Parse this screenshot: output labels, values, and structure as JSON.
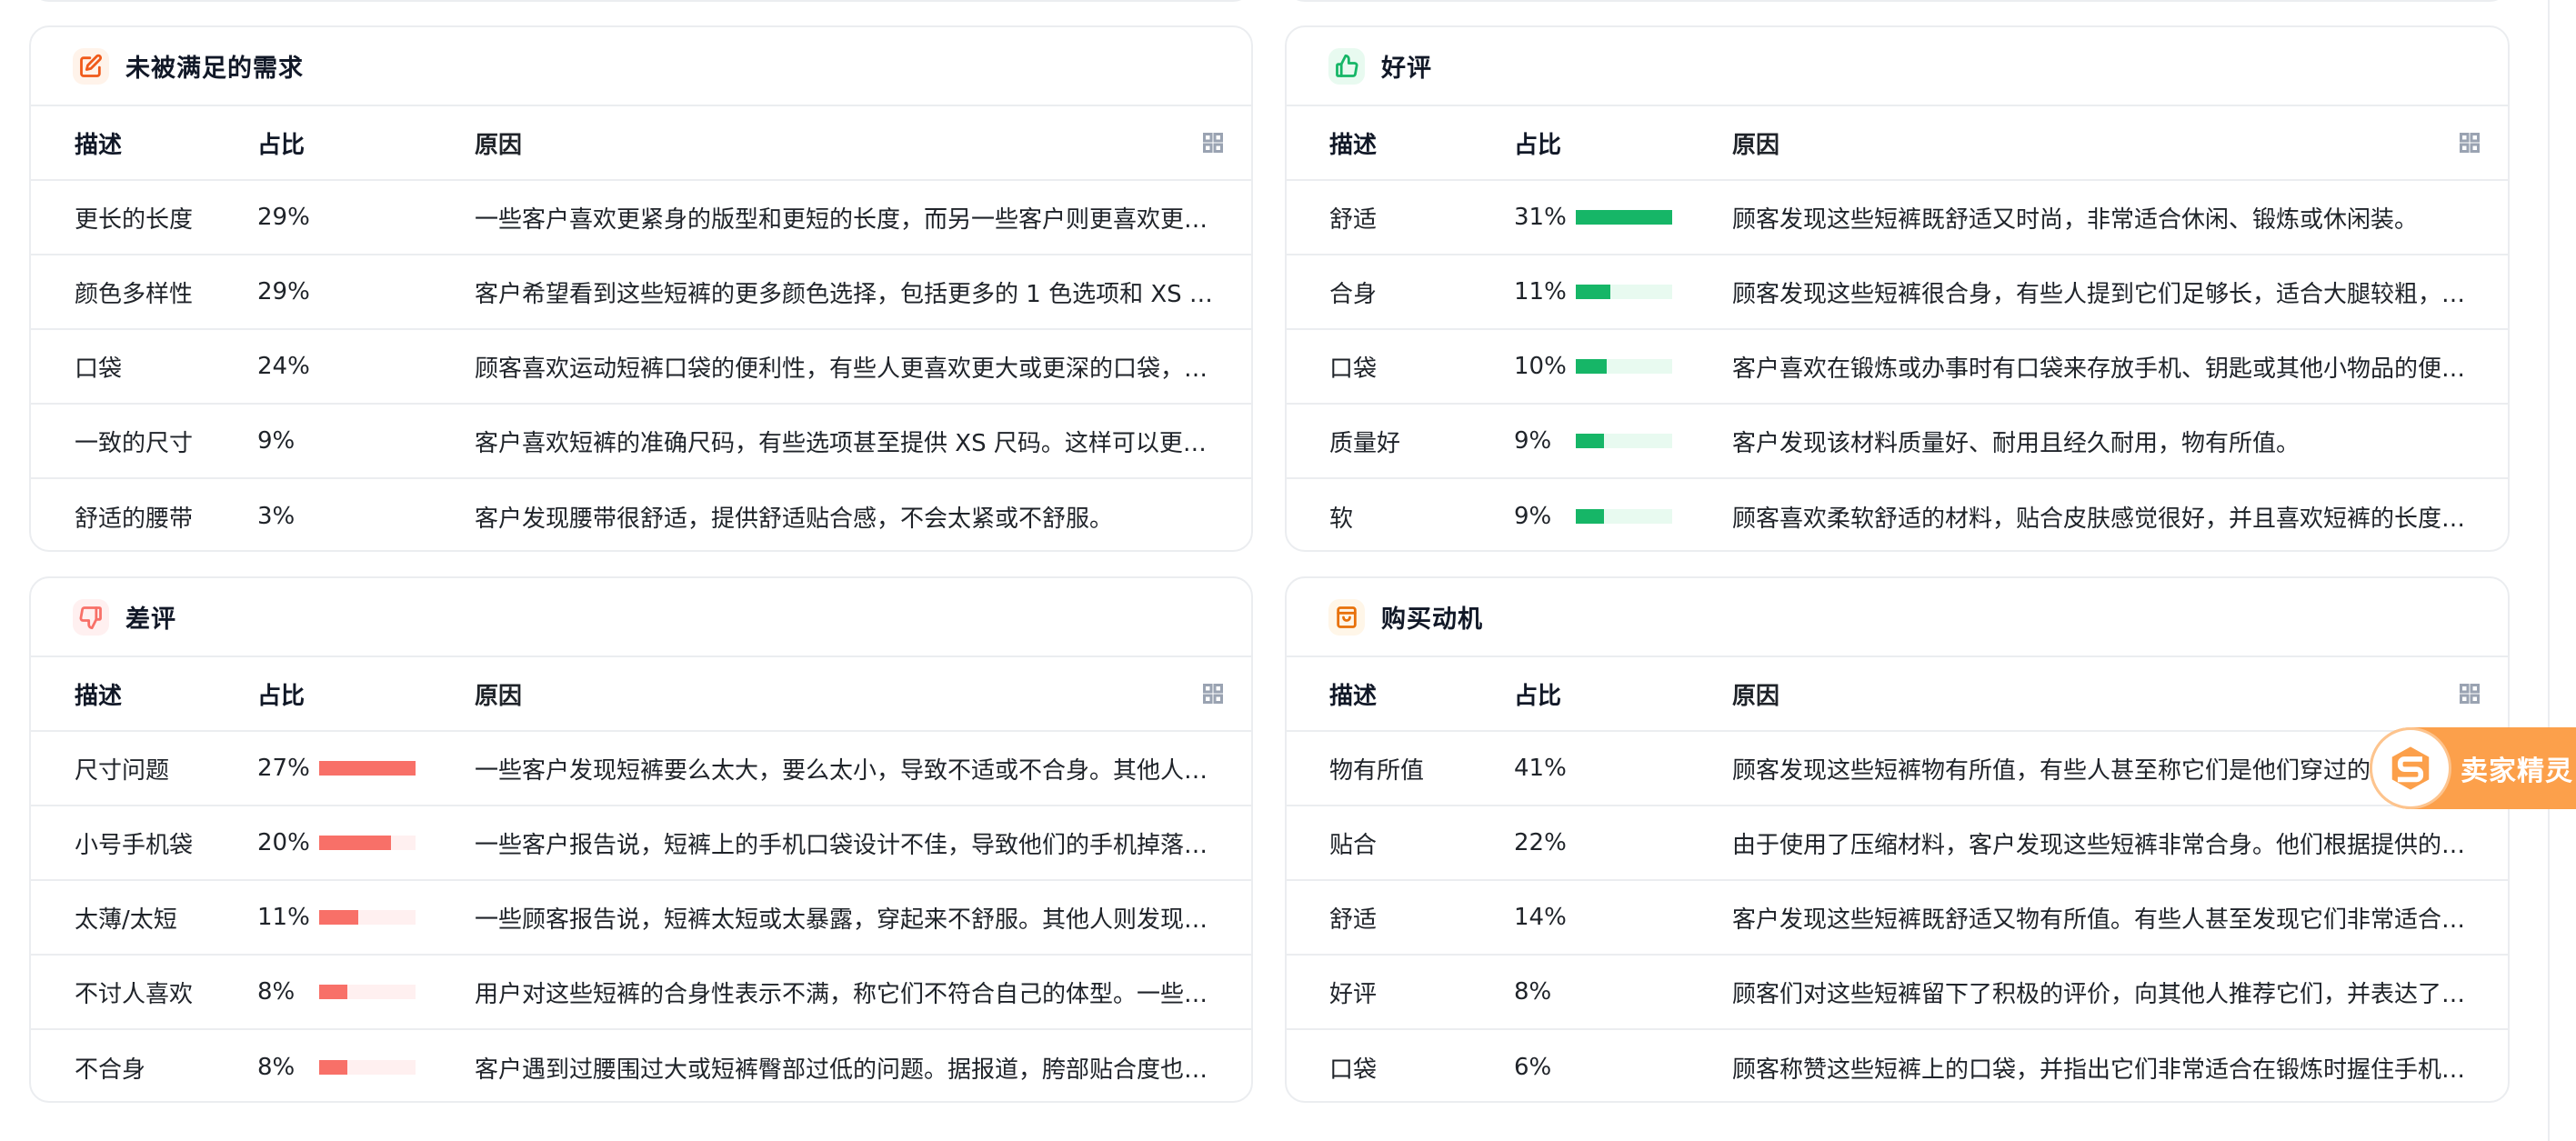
{
  "columns": {
    "desc": "描述",
    "pct": "占比",
    "reason": "原因"
  },
  "panels": {
    "unmet_needs": {
      "title": "未被满足的需求",
      "icon": "edit-icon",
      "accent": "#f05a1a",
      "show_bars": false,
      "rows": [
        {
          "desc": "更长的长度",
          "pct": "29%",
          "value": 29,
          "reason": "一些客户喜欢更紧身的版型和更短的长度，而另一些客户则更喜欢更宽松的版型和更长的长度。"
        },
        {
          "desc": "颜色多样性",
          "pct": "29%",
          "value": 29,
          "reason": "客户希望看到这些短裤的更多颜色选择，包括更多的 1 色选项和 XS 尺码。"
        },
        {
          "desc": "口袋",
          "pct": "24%",
          "value": 24,
          "reason": "顾客喜欢运动短裤口袋的便利性，有些人更喜欢更大或更深的口袋，以便存放手机。"
        },
        {
          "desc": "一致的尺寸",
          "pct": "9%",
          "value": 9,
          "reason": "客户喜欢短裤的准确尺码，有些选项甚至提供 XS 尺码。这样可以更好地合身。"
        },
        {
          "desc": "舒适的腰带",
          "pct": "3%",
          "value": 3,
          "reason": "客户发现腰带很舒适，提供舒适贴合感，不会太紧或不舒服。"
        }
      ]
    },
    "positive": {
      "title": "好评",
      "icon": "thumbs-up-icon",
      "accent": "#16b667",
      "show_bars": true,
      "bar_color": "#16b667",
      "bar_track": "#e8faf0",
      "rows": [
        {
          "desc": "舒适",
          "pct": "31%",
          "value": 31,
          "reason": "顾客发现这些短裤既舒适又时尚，非常适合休闲、锻炼或休闲装。"
        },
        {
          "desc": "合身",
          "pct": "11%",
          "value": 11,
          "reason": "顾客发现这些短裤很合身，有些人提到它们足够长，适合大腿较粗，而且弹性很好。"
        },
        {
          "desc": "口袋",
          "pct": "10%",
          "value": 10,
          "reason": "客户喜欢在锻炼或办事时有口袋来存放手机、钥匙或其他小物品的便利。"
        },
        {
          "desc": "质量好",
          "pct": "9%",
          "value": 9,
          "reason": "客户发现该材料质量好、耐用且经久耐用，物有所值。"
        },
        {
          "desc": "软",
          "pct": "9%",
          "value": 9,
          "reason": "顾客喜欢柔软舒适的材料，贴合皮肤感觉很好，并且喜欢短裤的长度不会太短。"
        }
      ]
    },
    "negative": {
      "title": "差评",
      "icon": "thumbs-down-icon",
      "accent": "#f87068",
      "show_bars": true,
      "bar_color": "#f87068",
      "bar_track": "#fff0f0",
      "rows": [
        {
          "desc": "尺寸问题",
          "pct": "27%",
          "value": 27,
          "reason": "一些客户发现短裤要么太大，要么太小，导致不适或不合身。其他人报告了尺码不一致的问题。"
        },
        {
          "desc": "小号手机袋",
          "pct": "20%",
          "value": 20,
          "reason": "一些客户报告说，短裤上的手机口袋设计不佳，导致他们的手机掉落或不方便取出。"
        },
        {
          "desc": "太薄/太短",
          "pct": "11%",
          "value": 11,
          "reason": "一些顾客报告说，短裤太短或太暴露，穿起来不舒服。其他人则发现短裤面料太薄。"
        },
        {
          "desc": "不讨人喜欢",
          "pct": "8%",
          "value": 8,
          "reason": "用户对这些短裤的合身性表示不满，称它们不符合自己的体型。一些顾客认为款式不好看。"
        },
        {
          "desc": "不合身",
          "pct": "8%",
          "value": 8,
          "reason": "客户遇到过腰围过大或短裤臀部过低的问题。据报道，胯部贴合度也很差。"
        }
      ]
    },
    "motivation": {
      "title": "购买动机",
      "icon": "shopping-bag-icon",
      "accent": "#e8710a",
      "show_bars": false,
      "rows": [
        {
          "desc": "物有所值",
          "pct": "41%",
          "value": 41,
          "reason": "顾客发现这些短裤物有所值，有些人甚至称它们是他们穿过的最好的短裤。"
        },
        {
          "desc": "贴合",
          "pct": "22%",
          "value": 22,
          "reason": "由于使用了压缩材料，客户发现这些短裤非常合身。他们根据提供的尺码表选择尺码。"
        },
        {
          "desc": "舒适",
          "pct": "14%",
          "value": 14,
          "reason": "客户发现这些短裤既舒适又物有所值。有些人甚至发现它们非常适合剧烈运动。"
        },
        {
          "desc": "好评",
          "pct": "8%",
          "value": 8,
          "reason": "顾客们对这些短裤留下了积极的评价，向其他人推荐它们，并表达了他们的满意。"
        },
        {
          "desc": "口袋",
          "pct": "6%",
          "value": 6,
          "reason": "顾客称赞这些短裤上的口袋，并指出它们非常适合在锻炼时握住手机或钥匙。"
        }
      ]
    }
  },
  "seller_badge": {
    "label": "卖家精灵",
    "icon": "seller-sprite-logo-icon",
    "color": "#fca04b"
  }
}
